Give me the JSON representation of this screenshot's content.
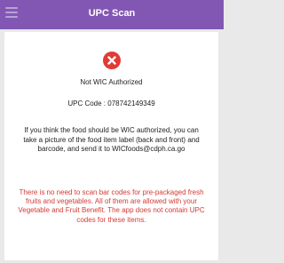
{
  "header": {
    "title": "UPC Scan",
    "background": "#8257b4",
    "menu_icon": "hamburger-menu-icon"
  },
  "result": {
    "icon": "error-x-circle-icon",
    "icon_color": "#e23a36",
    "status": "Not WIC Authorized",
    "upc_label": "UPC Code :",
    "upc_value": "078742149349",
    "upc_line": "UPC Code :  078742149349",
    "info": "If you think the food should be WIC authorized, you can take a picture of the food item label (back and front) and barcode, and send it to WICfoods@cdph.ca.go"
  },
  "notice": {
    "text": "There is no need to scan bar codes for pre-packaged fresh fruits and vegetables. All of them are allowed with your Vegetable and Fruit Benefit. The app does not contain UPC codes for these items.",
    "color": "#d53a35"
  }
}
